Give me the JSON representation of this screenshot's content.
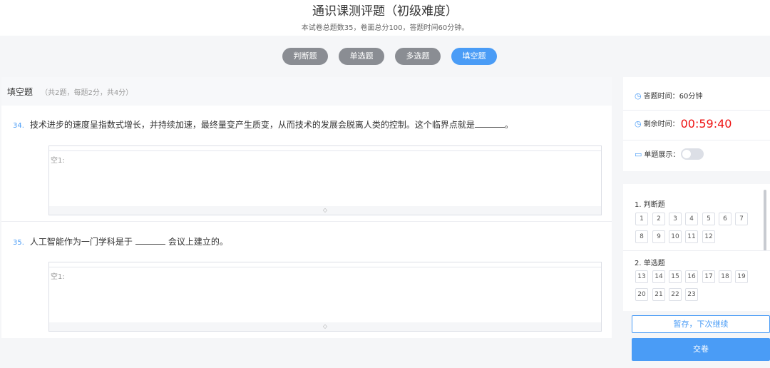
{
  "header": {
    "title": "通识课测评题（初级难度）",
    "subtitle": "本试卷总题数35，卷面总分100，答题时间60分钟。"
  },
  "tabs": [
    {
      "label": "判断题",
      "active": false
    },
    {
      "label": "单选题",
      "active": false
    },
    {
      "label": "多选题",
      "active": false
    },
    {
      "label": "填空题",
      "active": true
    }
  ],
  "section": {
    "title": "填空题",
    "info": "（共2题，每题2分，共4分）"
  },
  "questions": [
    {
      "number": "34.",
      "text_before": "技术进步的速度呈指数式增长，并持续加速，最终量变产生质变，从而技术的发展会脱离人类的控制。这个临界点就是",
      "text_after": "。",
      "blank_label": "空1:"
    },
    {
      "number": "35.",
      "text_before": "人工智能作为一门学科是于",
      "text_after": "会议上建立的。",
      "blank_label": "空1:"
    }
  ],
  "sidebar": {
    "time_label": "答题时间：60分钟",
    "remaining_label": "剩余时间：",
    "remaining_value": "00:59:40",
    "single_view_label": "单题展示：",
    "single_view_on": false,
    "groups": [
      {
        "title": "1. 判断题",
        "numbers": [
          "1",
          "2",
          "3",
          "4",
          "5",
          "6",
          "7",
          "8",
          "9",
          "10",
          "11",
          "12"
        ]
      },
      {
        "title": "2. 单选题",
        "numbers": [
          "13",
          "14",
          "15",
          "16",
          "17",
          "18",
          "19",
          "20",
          "21",
          "22",
          "23"
        ]
      }
    ],
    "pause_label": "暂存，下次继续",
    "submit_label": "交卷"
  },
  "colors": {
    "accent": "#4a9cf6",
    "timer": "#ee1111",
    "tab_inactive": "#8a8d93"
  }
}
